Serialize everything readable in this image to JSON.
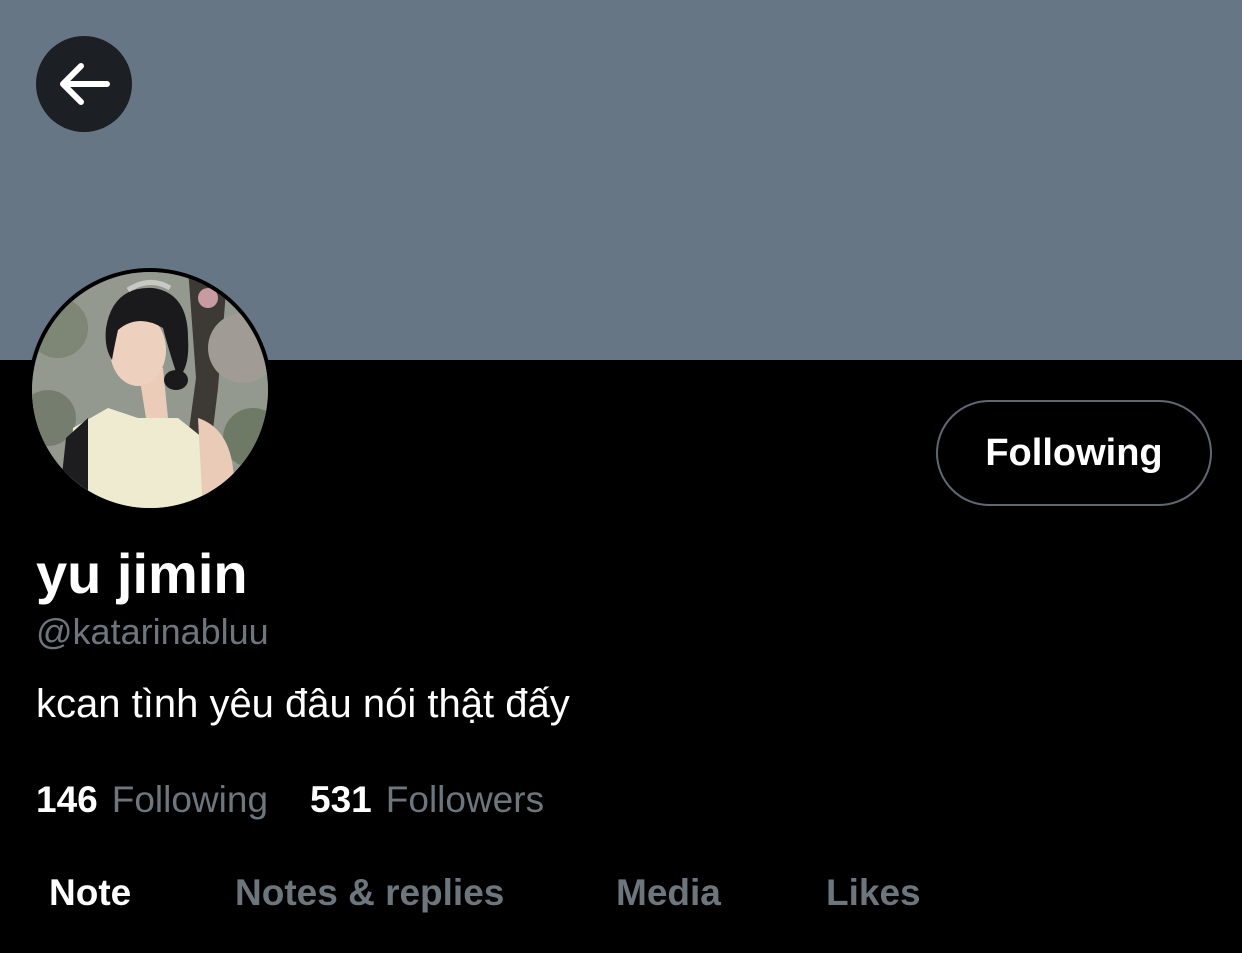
{
  "header": {
    "back_icon": "arrow-left-icon",
    "banner_color": "#677685"
  },
  "profile": {
    "avatar_description": "profile photo",
    "display_name": "yu jimin",
    "handle": "@katarinabluu",
    "bio": "kcan tình yêu đâu nói thật đấy",
    "follow_button_label": "Following"
  },
  "stats": {
    "following_count": "146",
    "following_label": "Following",
    "followers_count": "531",
    "followers_label": "Followers"
  },
  "tabs": [
    {
      "label": "Note",
      "active": true
    },
    {
      "label": "Notes & replies",
      "active": false
    },
    {
      "label": "Media",
      "active": false
    },
    {
      "label": "Likes",
      "active": false
    }
  ],
  "colors": {
    "background": "#000000",
    "muted_text": "#6e767d",
    "primary_text": "#ffffff",
    "button_border": "#5f6872"
  }
}
